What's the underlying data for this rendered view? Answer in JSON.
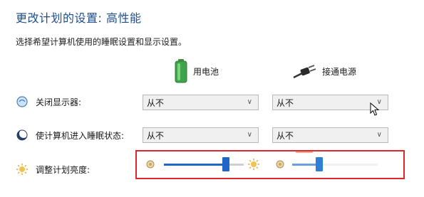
{
  "header": {
    "title": "更改计划的设置: 高性能",
    "subtitle": "选择希望计算机使用的睡眠设置和显示设置。"
  },
  "columns": {
    "battery_label": "用电池",
    "plugged_label": "接通电源"
  },
  "rows": {
    "display_off": {
      "label": "关闭显示器:",
      "battery_value": "从不",
      "plugged_value": "从不"
    },
    "sleep": {
      "label": "使计算机进入睡眠状态:",
      "battery_value": "从不",
      "plugged_value": "从不"
    },
    "brightness": {
      "label": "调整计划亮度:",
      "battery_level": 0.8,
      "plugged_level": 0.3
    }
  },
  "colors": {
    "title": "#1e4e8c",
    "highlight_box": "#e0262a",
    "slider_accent": "#1e66c8"
  }
}
